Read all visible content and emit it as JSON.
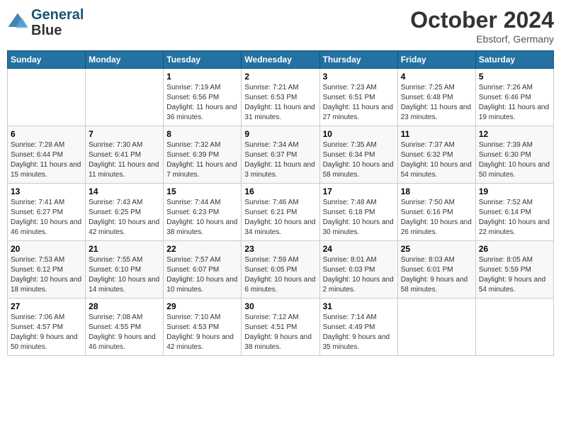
{
  "logo": {
    "line1": "General",
    "line2": "Blue"
  },
  "title": "October 2024",
  "location": "Ebstorf, Germany",
  "days_header": [
    "Sunday",
    "Monday",
    "Tuesday",
    "Wednesday",
    "Thursday",
    "Friday",
    "Saturday"
  ],
  "weeks": [
    [
      {
        "num": "",
        "sunrise": "",
        "sunset": "",
        "daylight": ""
      },
      {
        "num": "",
        "sunrise": "",
        "sunset": "",
        "daylight": ""
      },
      {
        "num": "1",
        "sunrise": "Sunrise: 7:19 AM",
        "sunset": "Sunset: 6:56 PM",
        "daylight": "Daylight: 11 hours and 36 minutes."
      },
      {
        "num": "2",
        "sunrise": "Sunrise: 7:21 AM",
        "sunset": "Sunset: 6:53 PM",
        "daylight": "Daylight: 11 hours and 31 minutes."
      },
      {
        "num": "3",
        "sunrise": "Sunrise: 7:23 AM",
        "sunset": "Sunset: 6:51 PM",
        "daylight": "Daylight: 11 hours and 27 minutes."
      },
      {
        "num": "4",
        "sunrise": "Sunrise: 7:25 AM",
        "sunset": "Sunset: 6:48 PM",
        "daylight": "Daylight: 11 hours and 23 minutes."
      },
      {
        "num": "5",
        "sunrise": "Sunrise: 7:26 AM",
        "sunset": "Sunset: 6:46 PM",
        "daylight": "Daylight: 11 hours and 19 minutes."
      }
    ],
    [
      {
        "num": "6",
        "sunrise": "Sunrise: 7:28 AM",
        "sunset": "Sunset: 6:44 PM",
        "daylight": "Daylight: 11 hours and 15 minutes."
      },
      {
        "num": "7",
        "sunrise": "Sunrise: 7:30 AM",
        "sunset": "Sunset: 6:41 PM",
        "daylight": "Daylight: 11 hours and 11 minutes."
      },
      {
        "num": "8",
        "sunrise": "Sunrise: 7:32 AM",
        "sunset": "Sunset: 6:39 PM",
        "daylight": "Daylight: 11 hours and 7 minutes."
      },
      {
        "num": "9",
        "sunrise": "Sunrise: 7:34 AM",
        "sunset": "Sunset: 6:37 PM",
        "daylight": "Daylight: 11 hours and 3 minutes."
      },
      {
        "num": "10",
        "sunrise": "Sunrise: 7:35 AM",
        "sunset": "Sunset: 6:34 PM",
        "daylight": "Daylight: 10 hours and 58 minutes."
      },
      {
        "num": "11",
        "sunrise": "Sunrise: 7:37 AM",
        "sunset": "Sunset: 6:32 PM",
        "daylight": "Daylight: 10 hours and 54 minutes."
      },
      {
        "num": "12",
        "sunrise": "Sunrise: 7:39 AM",
        "sunset": "Sunset: 6:30 PM",
        "daylight": "Daylight: 10 hours and 50 minutes."
      }
    ],
    [
      {
        "num": "13",
        "sunrise": "Sunrise: 7:41 AM",
        "sunset": "Sunset: 6:27 PM",
        "daylight": "Daylight: 10 hours and 46 minutes."
      },
      {
        "num": "14",
        "sunrise": "Sunrise: 7:43 AM",
        "sunset": "Sunset: 6:25 PM",
        "daylight": "Daylight: 10 hours and 42 minutes."
      },
      {
        "num": "15",
        "sunrise": "Sunrise: 7:44 AM",
        "sunset": "Sunset: 6:23 PM",
        "daylight": "Daylight: 10 hours and 38 minutes."
      },
      {
        "num": "16",
        "sunrise": "Sunrise: 7:46 AM",
        "sunset": "Sunset: 6:21 PM",
        "daylight": "Daylight: 10 hours and 34 minutes."
      },
      {
        "num": "17",
        "sunrise": "Sunrise: 7:48 AM",
        "sunset": "Sunset: 6:18 PM",
        "daylight": "Daylight: 10 hours and 30 minutes."
      },
      {
        "num": "18",
        "sunrise": "Sunrise: 7:50 AM",
        "sunset": "Sunset: 6:16 PM",
        "daylight": "Daylight: 10 hours and 26 minutes."
      },
      {
        "num": "19",
        "sunrise": "Sunrise: 7:52 AM",
        "sunset": "Sunset: 6:14 PM",
        "daylight": "Daylight: 10 hours and 22 minutes."
      }
    ],
    [
      {
        "num": "20",
        "sunrise": "Sunrise: 7:53 AM",
        "sunset": "Sunset: 6:12 PM",
        "daylight": "Daylight: 10 hours and 18 minutes."
      },
      {
        "num": "21",
        "sunrise": "Sunrise: 7:55 AM",
        "sunset": "Sunset: 6:10 PM",
        "daylight": "Daylight: 10 hours and 14 minutes."
      },
      {
        "num": "22",
        "sunrise": "Sunrise: 7:57 AM",
        "sunset": "Sunset: 6:07 PM",
        "daylight": "Daylight: 10 hours and 10 minutes."
      },
      {
        "num": "23",
        "sunrise": "Sunrise: 7:59 AM",
        "sunset": "Sunset: 6:05 PM",
        "daylight": "Daylight: 10 hours and 6 minutes."
      },
      {
        "num": "24",
        "sunrise": "Sunrise: 8:01 AM",
        "sunset": "Sunset: 6:03 PM",
        "daylight": "Daylight: 10 hours and 2 minutes."
      },
      {
        "num": "25",
        "sunrise": "Sunrise: 8:03 AM",
        "sunset": "Sunset: 6:01 PM",
        "daylight": "Daylight: 9 hours and 58 minutes."
      },
      {
        "num": "26",
        "sunrise": "Sunrise: 8:05 AM",
        "sunset": "Sunset: 5:59 PM",
        "daylight": "Daylight: 9 hours and 54 minutes."
      }
    ],
    [
      {
        "num": "27",
        "sunrise": "Sunrise: 7:06 AM",
        "sunset": "Sunset: 4:57 PM",
        "daylight": "Daylight: 9 hours and 50 minutes."
      },
      {
        "num": "28",
        "sunrise": "Sunrise: 7:08 AM",
        "sunset": "Sunset: 4:55 PM",
        "daylight": "Daylight: 9 hours and 46 minutes."
      },
      {
        "num": "29",
        "sunrise": "Sunrise: 7:10 AM",
        "sunset": "Sunset: 4:53 PM",
        "daylight": "Daylight: 9 hours and 42 minutes."
      },
      {
        "num": "30",
        "sunrise": "Sunrise: 7:12 AM",
        "sunset": "Sunset: 4:51 PM",
        "daylight": "Daylight: 9 hours and 38 minutes."
      },
      {
        "num": "31",
        "sunrise": "Sunrise: 7:14 AM",
        "sunset": "Sunset: 4:49 PM",
        "daylight": "Daylight: 9 hours and 35 minutes."
      },
      {
        "num": "",
        "sunrise": "",
        "sunset": "",
        "daylight": ""
      },
      {
        "num": "",
        "sunrise": "",
        "sunset": "",
        "daylight": ""
      }
    ]
  ]
}
